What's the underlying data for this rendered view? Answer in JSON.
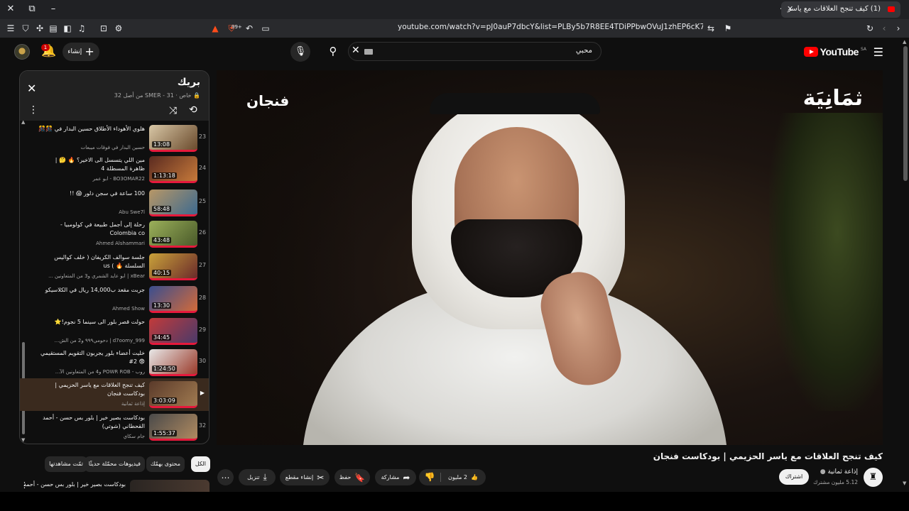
{
  "browser": {
    "tab_title": "(1) كيف تنجح العلاقات مع ياسر",
    "url": "youtube.com/watch?v=pJ0auP7dbcY&list=PLBy5b7R8EE4TDiPPbwOVuJ1zhEP6cK7X-&index=31",
    "badge_count": "99+"
  },
  "header": {
    "logo_text": "YouTube",
    "logo_country": "SA",
    "search_value": "محبي",
    "create_label": "إنشاء",
    "notif_count": "1"
  },
  "video": {
    "overlay_right": "ثمَانِيَة",
    "overlay_left": "فنجان",
    "title": "كيف تنجح العلاقات مع ياسر الحزيمي | بودكاست فنجان",
    "channel": "إذاعة ثمانية",
    "subs": "5.12 مليون مشترك",
    "subscribe": "اشتراك",
    "likes": "2 مليون",
    "share": "مشاركة",
    "save": "حفظ",
    "clip": "إنشاء مقطع",
    "download": "تنزيل"
  },
  "playlist": {
    "title": "بريك",
    "meta": "خاص · SMER - 31 من أصل 32",
    "items": [
      {
        "idx": "23",
        "title": "هلوي الأهوداء الأطلاق حسين البدار في 🎊🎊",
        "channel": "حسين البدار في فوقات ميبعات",
        "dur": "13:08"
      },
      {
        "idx": "24",
        "title": "مين اللي يتسسل الى الاخير؟ 🔥 🤔 | ظاهرة المسطلة 4",
        "channel": "BO3OMAR22 - ابو عمر",
        "dur": "1:13:18"
      },
      {
        "idx": "25",
        "title": "100 ساعة في سجن دلور 😱 !!",
        "channel": "Abu Swe7l",
        "dur": "58:48"
      },
      {
        "idx": "26",
        "title": "رحلة إلى أجمل طبيعة في كولومبيا - Colombia co",
        "channel": "Ahmed Alshammari",
        "dur": "43:48"
      },
      {
        "idx": "27",
        "title": "جلسة سوالف الكريفان ( خلف كواليس السلسلة 🔥 ) us",
        "channel": "xBear | ابو عايد الشمري و3 من المتعاونين ...",
        "dur": "40:15"
      },
      {
        "idx": "28",
        "title": "جربت مقعد ب14,000 ريال في الكلاسيكو",
        "channel": "Ahmed Show",
        "dur": "13:30"
      },
      {
        "idx": "29",
        "title": "حولت قصر بلور الى سينما 5 نجوم!⭐",
        "channel": "d7oomy_999 | دحومي٩٩٩ و2 من الش...",
        "dur": "34:45"
      },
      {
        "idx": "30",
        "title": "خليت أعضاء بلور يجربون التقويم المستقيمي 😨 2#",
        "channel": "روب - POWR ROB و4 من المتعاونين الآ...",
        "dur": "1:24:50"
      },
      {
        "idx": "▶",
        "title": "كيف تنجح العلاقات مع ياسر الحزيمي | بودكاست فنجان",
        "channel": "إذاعة ثمانية",
        "dur": "3:03:09"
      },
      {
        "idx": "32",
        "title": "بودكاست بصير خير | بلور بس حسن - أحمد القحطاني (شوتي)",
        "channel": "جام سكاي",
        "dur": "1:55:37"
      }
    ]
  },
  "chips": [
    "الكل",
    "محتوى بهمّك",
    "فيديوهات محمّلة حديثًا",
    "تمّت مشاهدتها"
  ],
  "next_peek": "بودكاست بصير خير | بلور بس حسن - أحمد"
}
